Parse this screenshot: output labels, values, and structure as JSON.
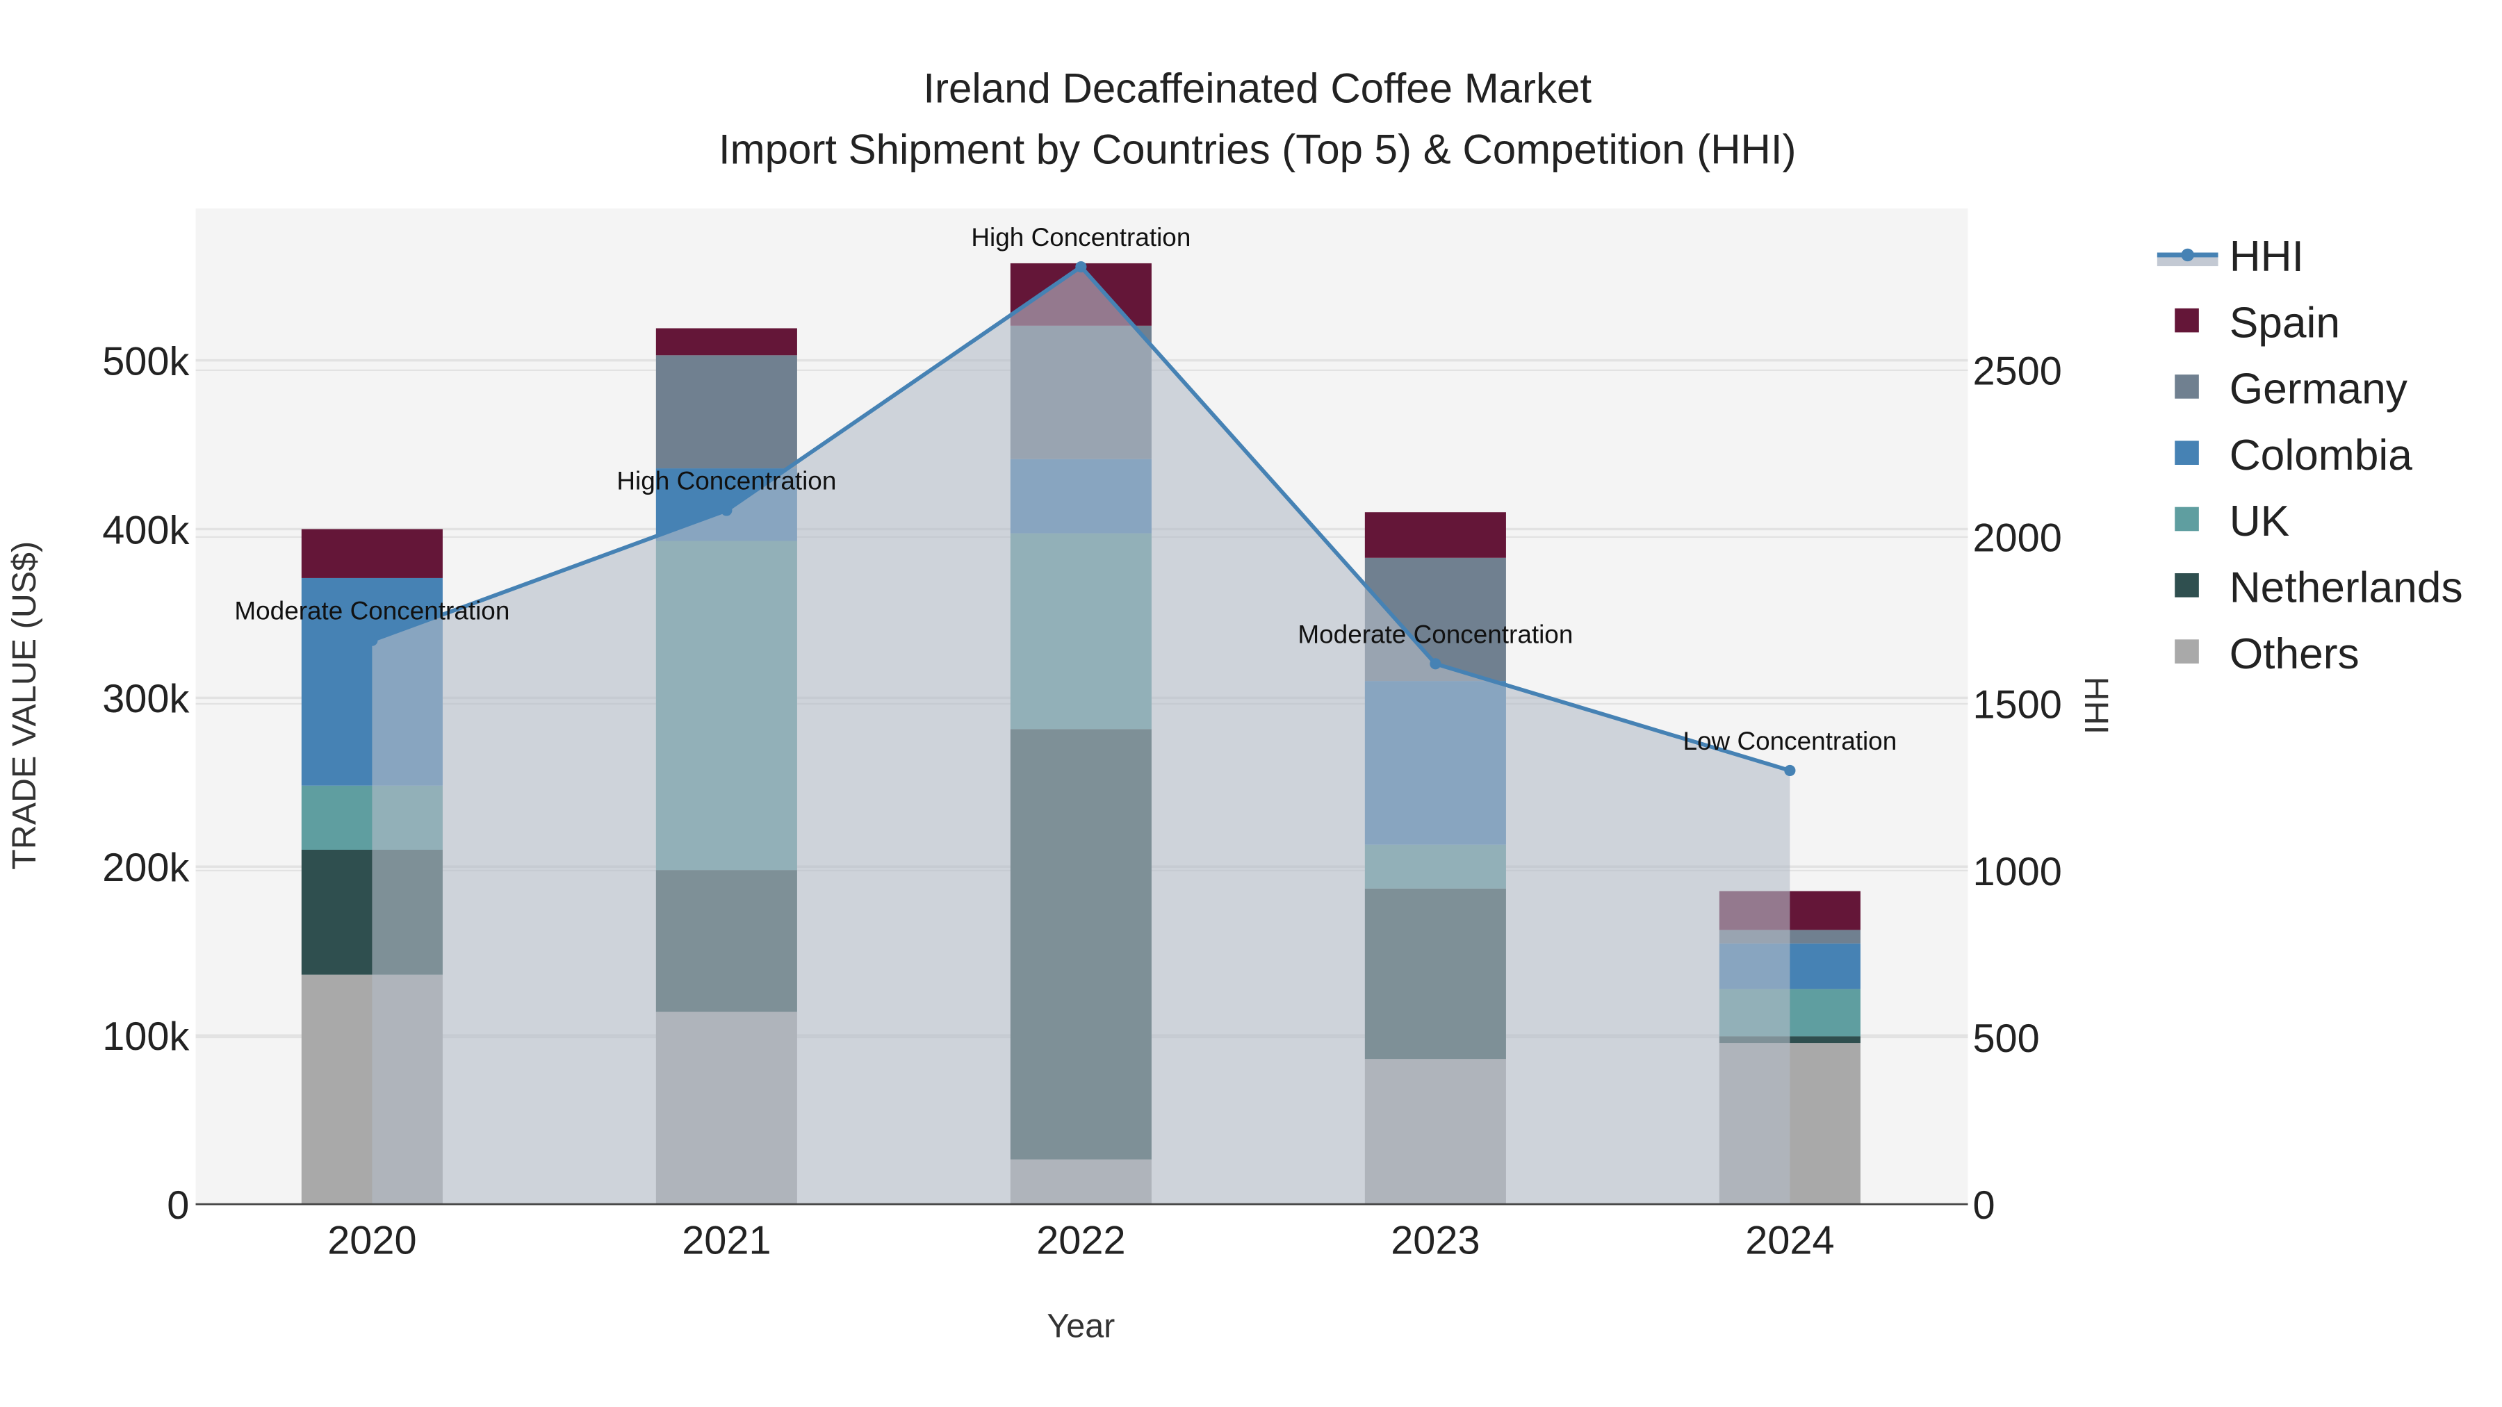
{
  "chart_data": {
    "type": "bar",
    "stacked": true,
    "title": "Ireland Decaffeinated Coffee Market",
    "subtitle": "Import Shipment by Countries (Top 5) & Competition (HHI)",
    "xlabel": "Year",
    "ylabel": "TRADE VALUE (US$)",
    "y2label": "HHI",
    "categories": [
      "2020",
      "2021",
      "2022",
      "2023",
      "2024"
    ],
    "ylim": [
      0,
      590000
    ],
    "y2lim": [
      0,
      2985
    ],
    "yticks": [
      0,
      100000,
      200000,
      300000,
      400000,
      500000
    ],
    "ytick_labels": [
      "0",
      "100k",
      "200k",
      "300k",
      "400k",
      "500k"
    ],
    "y2ticks": [
      0,
      500,
      1000,
      1500,
      2000,
      2500
    ],
    "y2tick_labels": [
      "0",
      "500",
      "1000",
      "1500",
      "2000",
      "2500"
    ],
    "grid": true,
    "legend_position": "right",
    "series": [
      {
        "name": "Others",
        "color": "#a9a9a9",
        "values": [
          136000,
          114000,
          26500,
          86000,
          95500
        ]
      },
      {
        "name": "Netherlands",
        "color": "#2f4f4f",
        "values": [
          74000,
          84000,
          255000,
          101000,
          4000
        ]
      },
      {
        "name": "UK",
        "color": "#5f9ea0",
        "values": [
          38000,
          195000,
          116000,
          26000,
          28000
        ]
      },
      {
        "name": "Colombia",
        "color": "#4682b4",
        "values": [
          123000,
          43000,
          44000,
          97000,
          27000
        ]
      },
      {
        "name": "Germany",
        "color": "#708090",
        "values": [
          0,
          67000,
          79000,
          73000,
          8000
        ]
      },
      {
        "name": "Spain",
        "color": "#641638",
        "values": [
          29000,
          16000,
          37000,
          27000,
          23000
        ]
      }
    ],
    "hhi": {
      "name": "HHI",
      "color": "#4682b4",
      "values": [
        1690,
        2080,
        2810,
        1620,
        1300
      ],
      "annotations": [
        "Moderate Concentration",
        "High Concentration",
        "High Concentration",
        "Moderate Concentration",
        "Low Concentration"
      ]
    },
    "legend": [
      "HHI",
      "Spain",
      "Germany",
      "Colombia",
      "UK",
      "Netherlands",
      "Others"
    ]
  }
}
